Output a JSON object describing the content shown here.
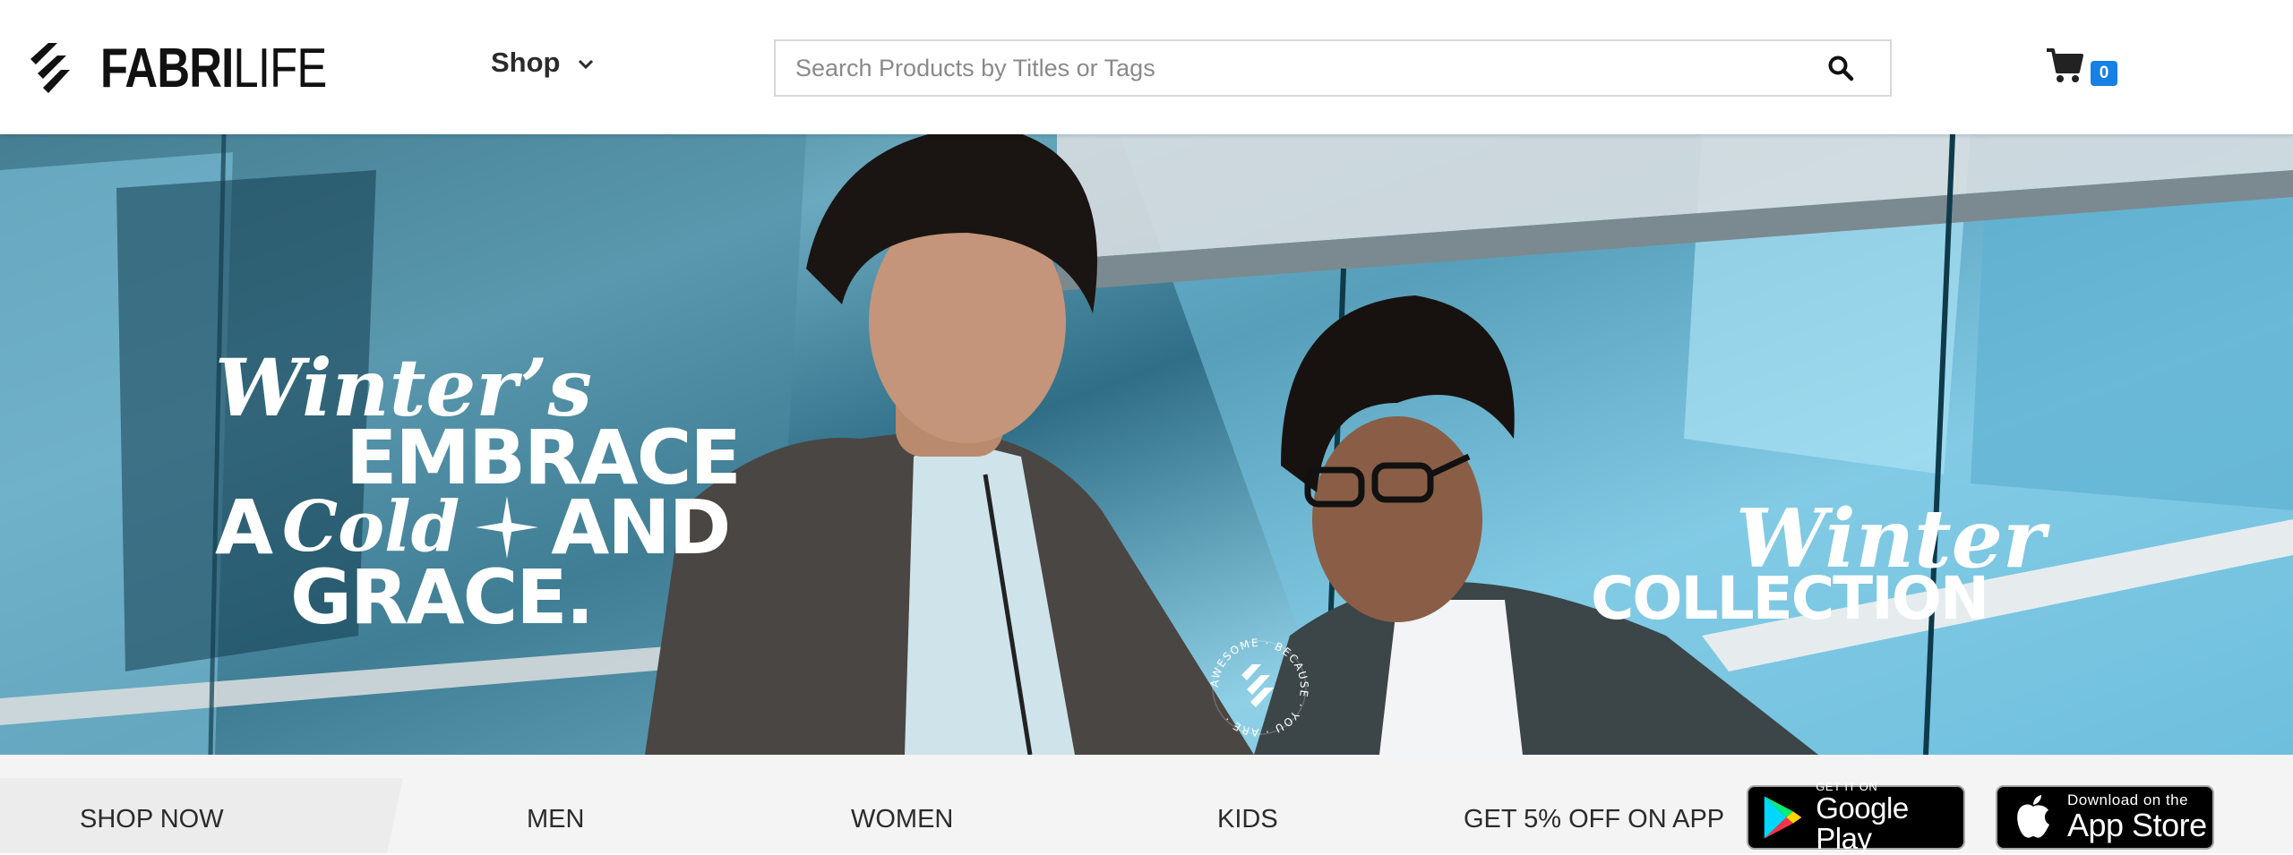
{
  "header": {
    "logo": {
      "bold_part": "FABRI",
      "light_part": "LIFE"
    },
    "shop_menu": {
      "label": "Shop",
      "icon": "chevron-down-icon"
    },
    "search": {
      "placeholder": "Search Products by Titles or Tags",
      "value": "",
      "icon": "search-icon"
    },
    "cart": {
      "icon": "shopping-cart-icon",
      "count": "0"
    }
  },
  "hero": {
    "tagline": {
      "line1": "Winter’s",
      "line2": "EMBRACE",
      "line3_a": "A",
      "line3_b": "Cold",
      "line3_c": "AND",
      "line4": "GRACE."
    },
    "collection": {
      "script": "Winter",
      "bold": "COLLECTION"
    },
    "seal_text": "AWESOME · BECAUSE · YOU · ARE ·"
  },
  "bottom_bar": {
    "shop_now": "SHOP NOW",
    "categories": [
      "MEN",
      "WOMEN",
      "KIDS"
    ],
    "promo": "GET 5% OFF ON APP",
    "google_play": {
      "small": "GET IT ON",
      "big": "Google Play"
    },
    "app_store": {
      "small": "Download on the",
      "big": "App Store"
    }
  },
  "colors": {
    "badge_blue": "#1680e5",
    "text_dark": "#2b2b2b",
    "hero_sky": "#62b6d6"
  }
}
